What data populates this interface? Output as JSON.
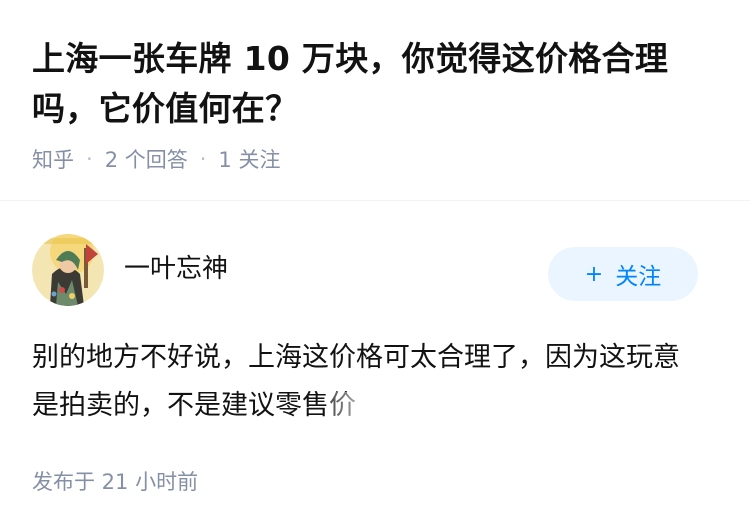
{
  "question": {
    "title": "上海一张车牌 10 万块，你觉得这价格合理吗，它价值何在？",
    "source": "知乎",
    "answers": "2 个回答",
    "followers": "1 关注"
  },
  "answer": {
    "author": "一叶忘神",
    "follow_label": "关注",
    "text": "别的地方不好说，上海这价格可太合理了，因为这玩意是拍卖的，不是建议零售价",
    "published": "发布于 21 小时前"
  },
  "colors": {
    "accent": "#0084ff",
    "follow_bg": "#ebf5ff",
    "meta": "#8590a6"
  }
}
